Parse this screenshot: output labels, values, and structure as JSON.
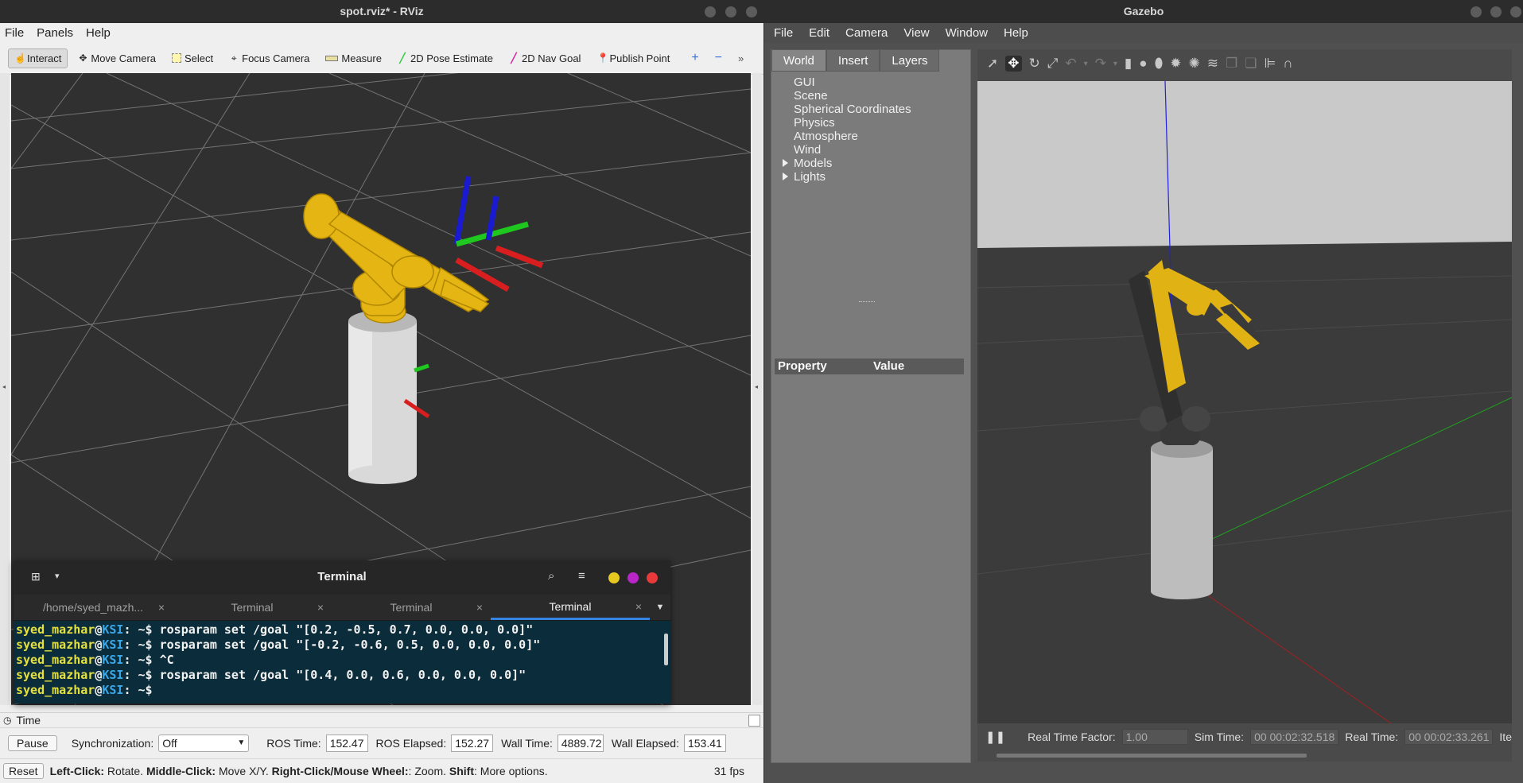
{
  "rviz": {
    "window_title": "spot.rviz* - RViz",
    "menu": [
      "File",
      "Panels",
      "Help"
    ],
    "tools": [
      {
        "label": "Interact",
        "icon": "hand-pointer-icon"
      },
      {
        "label": "Move Camera",
        "icon": "move-camera-icon"
      },
      {
        "label": "Select",
        "icon": "select-box-icon"
      },
      {
        "label": "Focus Camera",
        "icon": "focus-camera-icon"
      },
      {
        "label": "Measure",
        "icon": "ruler-icon"
      },
      {
        "label": "2D Pose Estimate",
        "icon": "green-arrow-icon"
      },
      {
        "label": "2D Nav Goal",
        "icon": "magenta-arrow-icon"
      },
      {
        "label": "Publish Point",
        "icon": "map-pin-icon"
      }
    ],
    "colors": {
      "pose_estimate": "#2ecc40",
      "nav_goal": "#d020a0",
      "publish_point": "#b8461d"
    }
  },
  "terminal": {
    "title": "Terminal",
    "tabs": [
      "/home/syed_mazh...",
      "Terminal",
      "Terminal",
      "Terminal"
    ],
    "lines": [
      {
        "user": "syed_mazhar",
        "host": "KSI",
        "cmd": " rosparam set /goal \"[0.2, -0.5, 0.7, 0.0, 0.0, 0.0]\""
      },
      {
        "user": "syed_mazhar",
        "host": "KSI",
        "cmd": " rosparam set /goal \"[-0.2, -0.6, 0.5, 0.0, 0.0, 0.0]\""
      },
      {
        "user": "syed_mazhar",
        "host": "KSI",
        "cmd": " ^C"
      },
      {
        "user": "syed_mazhar",
        "host": "KSI",
        "cmd": " rosparam set /goal \"[0.4, 0.0, 0.6, 0.0, 0.0, 0.0]\""
      },
      {
        "user": "syed_mazhar",
        "host": "KSI",
        "cmd": ""
      }
    ],
    "prompt_suffix": ": ~$"
  },
  "time_panel": {
    "title": "Time",
    "pause_label": "Pause",
    "sync_label": "Synchronization:",
    "sync_value": "Off",
    "ros_time_label": "ROS Time:",
    "ros_time": "152.47",
    "ros_elapsed_label": "ROS Elapsed:",
    "ros_elapsed": "152.27",
    "wall_time_label": "Wall Time:",
    "wall_time": "4889.72",
    "wall_elapsed_label": "Wall Elapsed:",
    "wall_elapsed": "153.41",
    "reset_label": "Reset",
    "help_parts": [
      {
        "b": "Left-Click:",
        "t": " Rotate. "
      },
      {
        "b": "Middle-Click:",
        "t": " Move X/Y. "
      },
      {
        "b": "Right-Click/Mouse Wheel:",
        "t": ": Zoom. "
      },
      {
        "b": "Shift",
        "t": ": More options."
      }
    ],
    "fps": "31 fps"
  },
  "gazebo": {
    "window_title": "Gazebo",
    "menu": [
      "File",
      "Edit",
      "Camera",
      "View",
      "Window",
      "Help"
    ],
    "tabs": [
      "World",
      "Insert",
      "Layers"
    ],
    "tree": [
      "GUI",
      "Scene",
      "Spherical Coordinates",
      "Physics",
      "Atmosphere",
      "Wind",
      "Models",
      "Lights"
    ],
    "prop_cols": [
      "Property",
      "Value"
    ],
    "rtf_label": "Real Time Factor:",
    "rtf": "1.00",
    "sim_label": "Sim Time:",
    "sim_time": "00 00:02:32.518",
    "real_label": "Real Time:",
    "real_time": "00 00:02:33.261",
    "iter_label": "Ite"
  }
}
